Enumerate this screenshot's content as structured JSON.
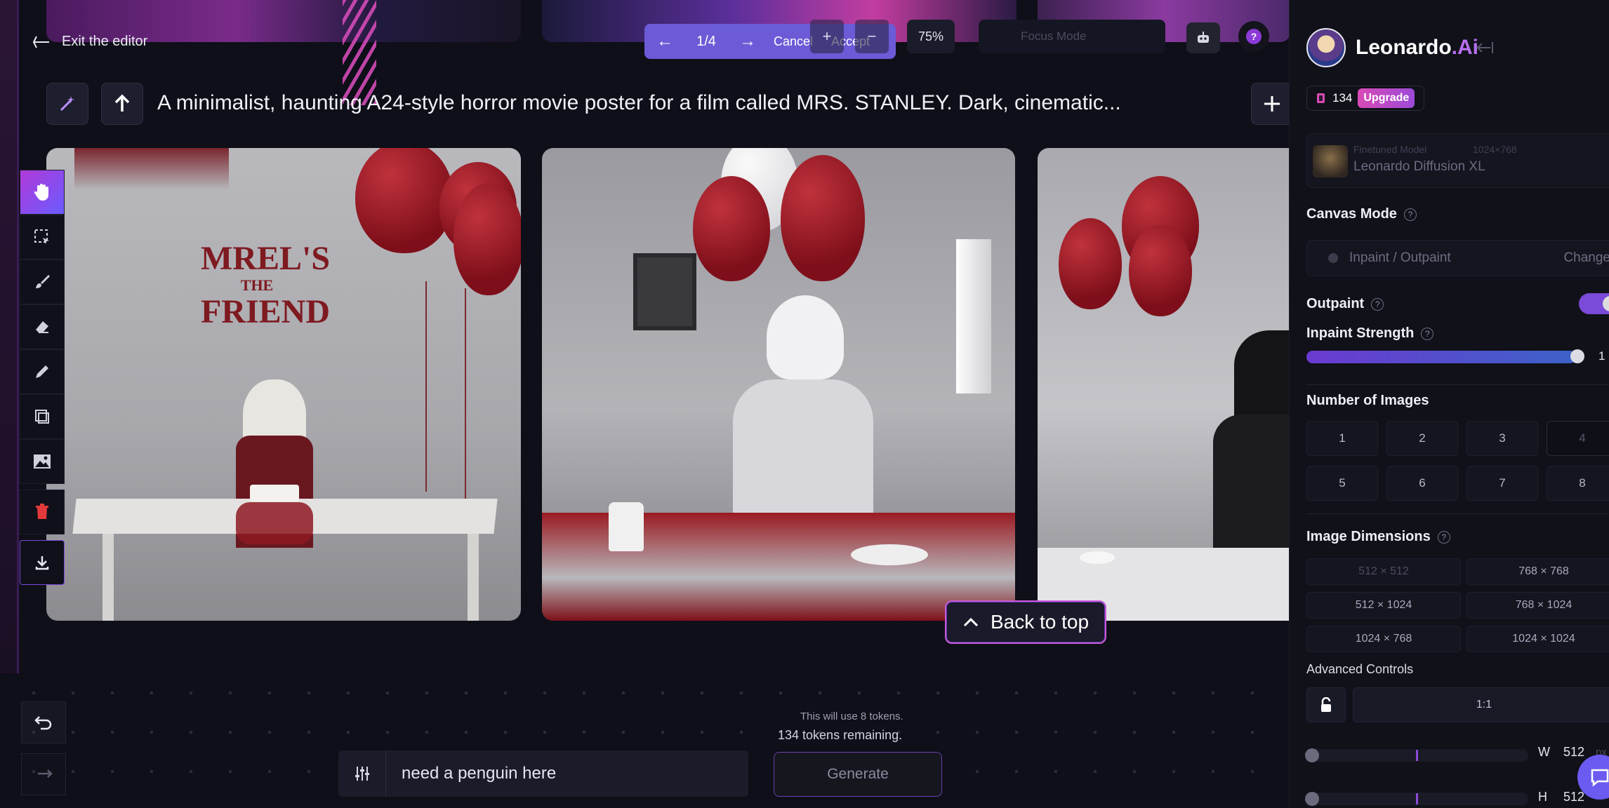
{
  "app": {
    "brand": "Leonardo",
    "brand_suffix": ".Ai"
  },
  "topbar": {
    "exit_label": "Exit the editor",
    "pager": "1/4",
    "cancel_label": "Cancel",
    "accept_label": "Accept",
    "zoom": "75%",
    "focus_mode_label": "Focus Mode"
  },
  "prompt": {
    "text": "A minimalist, haunting A24-style horror movie poster for a film called MRS. STANLEY. Dark, cinematic..."
  },
  "image1": {
    "wall_text_line1": "MREL'S",
    "wall_text_line2": "THE",
    "wall_text_line3": "FRIEND"
  },
  "back_to_top_label": "Back to top",
  "generation": {
    "token_cost": "This will use 8 tokens.",
    "tokens_remaining": "134 tokens remaining.",
    "input_value": "need a penguin here",
    "generate_label": "Generate"
  },
  "sidebar": {
    "tokens": "134",
    "upgrade_label": "Upgrade",
    "model": {
      "label": "Finetuned Model",
      "resolution": "1024×768",
      "name": "Leonardo Diffusion XL"
    },
    "canvas_mode": {
      "title": "Canvas Mode",
      "value": "Inpaint / Outpaint",
      "change_label": "Change"
    },
    "outpaint_label": "Outpaint",
    "outpaint_on": true,
    "inpaint_strength": {
      "label": "Inpaint Strength",
      "value": "1"
    },
    "num_images": {
      "title": "Number of Images",
      "options": [
        "1",
        "2",
        "3",
        "4",
        "5",
        "6",
        "7",
        "8"
      ],
      "selected": "4"
    },
    "dimensions": {
      "title": "Image Dimensions",
      "options": [
        "512 × 512",
        "768 × 768",
        "512 × 1024",
        "768 × 1024",
        "1024 × 768",
        "1024 × 1024"
      ],
      "selected": "512 × 512"
    },
    "advanced_label": "Advanced Controls",
    "aspect_ratio": "1:1",
    "width": {
      "label": "W",
      "value": "512",
      "unit": "px"
    },
    "height": {
      "label": "H",
      "value": "512"
    }
  },
  "colors": {
    "accent": "#6b5bd6",
    "brand_purple": "#b870f0",
    "upgrade": "#d84ab6"
  },
  "icons": [
    "arrow-left-icon",
    "magic-wand-icon",
    "arrow-up-icon",
    "plus-icon",
    "hand-icon",
    "select-icon",
    "brush-icon",
    "eraser-icon",
    "pencil-icon",
    "layers-icon",
    "image-icon",
    "trash-icon",
    "download-icon",
    "undo-icon",
    "redo-icon",
    "sliders-icon",
    "robot-icon",
    "help-icon",
    "chevron-up-icon",
    "lock-icon",
    "chat-icon"
  ]
}
